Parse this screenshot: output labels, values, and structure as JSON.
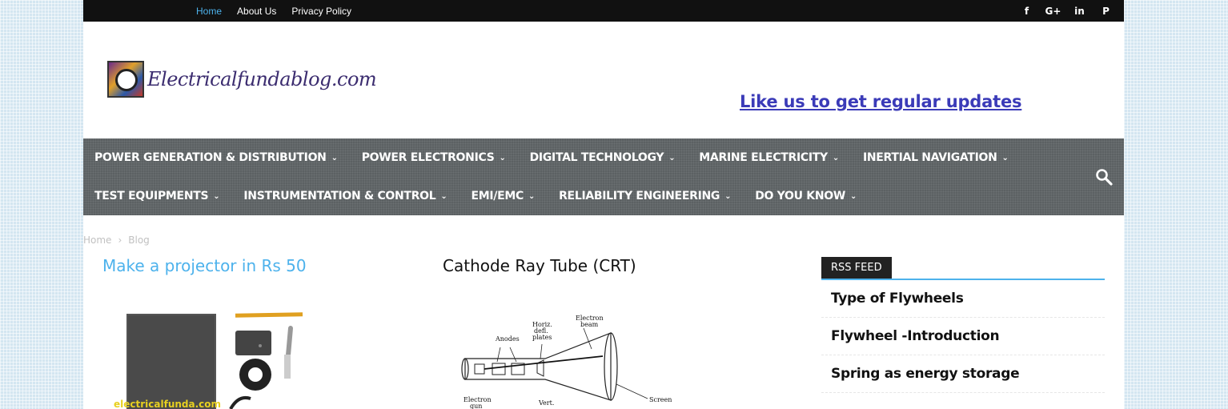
{
  "topbar": {
    "menu": [
      {
        "label": "Home",
        "active": true
      },
      {
        "label": "About Us",
        "active": false
      },
      {
        "label": "Privacy Policy",
        "active": false
      }
    ],
    "social": [
      "facebook-icon",
      "google-plus-icon",
      "linkedin-icon",
      "pinterest-icon"
    ],
    "social_glyphs": [
      "f",
      "G+",
      "in",
      "P"
    ]
  },
  "header": {
    "logo_text": "Electricalfundablog.com",
    "like_link": "Like us to get regular updates"
  },
  "nav": {
    "row1": [
      "POWER GENERATION & DISTRIBUTION",
      "POWER ELECTRONICS",
      "DIGITAL TECHNOLOGY",
      "MARINE ELECTRICITY",
      "INERTIAL NAVIGATION"
    ],
    "row2": [
      "TEST EQUIPMENTS",
      "INSTRUMENTATION & CONTROL",
      "EMI/EMC",
      "RELIABILITY ENGINEERING",
      "DO YOU KNOW"
    ]
  },
  "breadcrumb": {
    "home": "Home",
    "sep": "›",
    "current": "Blog"
  },
  "posts": [
    {
      "title": "Make a projector in Rs 50",
      "watermark": "electricalfunda.com"
    },
    {
      "title": "Cathode Ray Tube (CRT)",
      "diagram_labels": {
        "anodes": "Anodes",
        "horiz1": "Horiz.",
        "horiz2": "defl.",
        "horiz3": "plates",
        "beam1": "Electron",
        "beam2": "beam",
        "gun1": "Electron",
        "gun2": "gun",
        "vert": "Vert.",
        "screen": "Screen"
      }
    }
  ],
  "sidebar": {
    "rss_title": "RSS FEED",
    "items": [
      "Type of Flywheels",
      "Flywheel -Introduction",
      "Spring as energy storage"
    ]
  },
  "colors": {
    "accent": "#4db2ec",
    "nav_bg": "#5c6163",
    "topbar_bg": "#111111",
    "like_link": "#3b3bb8"
  }
}
